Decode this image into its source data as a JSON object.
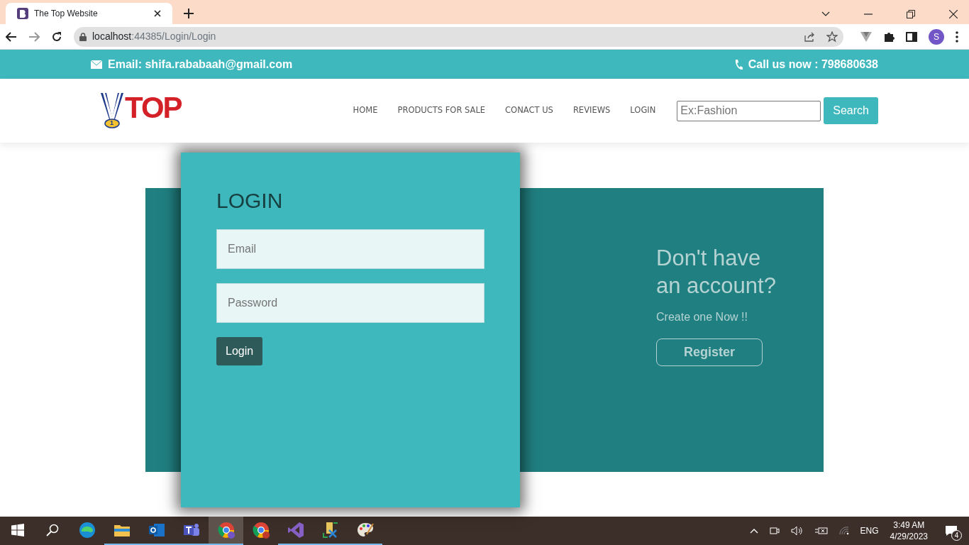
{
  "browser": {
    "tab_title": "The Top Website",
    "url_host": "localhost",
    "url_path": ":44385/Login/Login",
    "profile_initial": "S"
  },
  "top_bar": {
    "email": "Email: shifa.rababaah@gmail.com",
    "phone": "Call us now : 798680638"
  },
  "navbar": {
    "logo": "TOP",
    "logo_badge": "1",
    "links": [
      {
        "label": "HOME"
      },
      {
        "label": "PRODUCTS FOR SALE"
      },
      {
        "label": "CONACT US"
      },
      {
        "label": "REVIEWS"
      },
      {
        "label": "LOGIN"
      }
    ],
    "search": {
      "placeholder": "Ex:Fashion",
      "button": "Search"
    }
  },
  "login": {
    "title": "LOGIN",
    "email_placeholder": "Email",
    "password_placeholder": "Password",
    "button": "Login"
  },
  "register": {
    "heading": "Don't have an account?",
    "subtext": "Create one Now !!",
    "button": "Register"
  },
  "taskbar": {
    "apps": [
      {
        "kind": "edge",
        "running": false,
        "selected": false
      },
      {
        "kind": "folder",
        "running": true,
        "selected": false
      },
      {
        "kind": "outlook",
        "running": true,
        "selected": false
      },
      {
        "kind": "teams",
        "running": true,
        "selected": false
      },
      {
        "kind": "chrome",
        "running": true,
        "selected": true
      },
      {
        "kind": "chrome2",
        "running": false,
        "selected": false
      },
      {
        "kind": "vs",
        "running": true,
        "selected": false
      },
      {
        "kind": "tool",
        "running": true,
        "selected": false
      },
      {
        "kind": "paint",
        "running": true,
        "selected": false
      }
    ],
    "language": "ENG",
    "time": "3:49 AM",
    "date": "4/29/2023",
    "notifications": "4"
  }
}
